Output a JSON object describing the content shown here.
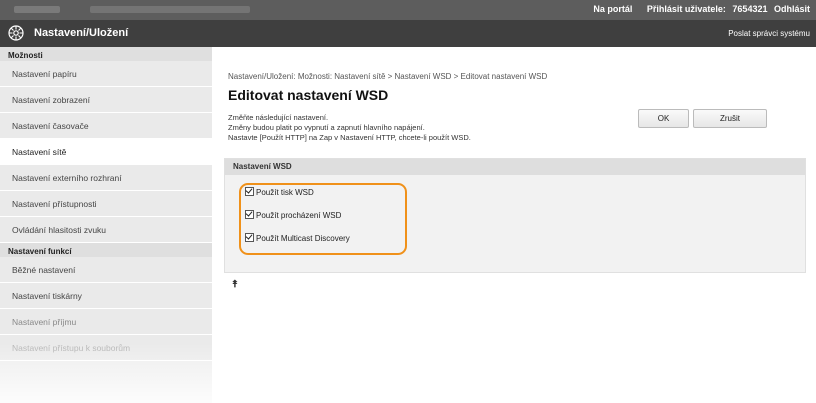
{
  "topbar": {
    "portal_label": "Na portál",
    "login_label": "Přihlásit uživatele:",
    "user_id": "7654321",
    "logout_label": "Odhlásit"
  },
  "header": {
    "title": "Nastavení/Uložení",
    "mail_label": "Poslat správci systému"
  },
  "sidebar": {
    "section1": "Možnosti",
    "items1": [
      {
        "label": "Nastavení papíru"
      },
      {
        "label": "Nastavení zobrazení"
      },
      {
        "label": "Nastavení časovače"
      },
      {
        "label": "Nastavení sítě"
      },
      {
        "label": "Nastavení externího rozhraní"
      },
      {
        "label": "Nastavení přístupnosti"
      },
      {
        "label": "Ovládání hlasitosti zvuku"
      }
    ],
    "section2": "Nastavení funkcí",
    "items2": [
      {
        "label": "Běžné nastavení"
      },
      {
        "label": "Nastavení tiskárny"
      },
      {
        "label": "Nastavení příjmu"
      },
      {
        "label": "Nastavení přístupu k souborům"
      }
    ]
  },
  "main": {
    "breadcrumb": "Nastavení/Uložení: Možnosti: Nastavení sítě > Nastavení WSD > Editovat nastavení WSD",
    "heading": "Editovat nastavení WSD",
    "notes": [
      "Změňte následující nastavení.",
      "Změny budou platit po vypnutí a zapnutí hlavního napájení.",
      "Nastavte [Použít HTTP] na Zap v Nastavení HTTP, chcete-li použít WSD."
    ],
    "ok_label": "OK",
    "cancel_label": "Zrušit",
    "panel_title": "Nastavení WSD",
    "options": [
      {
        "label": "Použít tisk WSD",
        "checked": true
      },
      {
        "label": "Použít procházení WSD",
        "checked": true
      },
      {
        "label": "Použít Multicast Discovery",
        "checked": true
      }
    ],
    "to_top_glyph": "⯭"
  },
  "colors": {
    "highlight": "#f0911a",
    "title_bar": "#3f3f3f",
    "status_bar": "#5d5d5d"
  }
}
